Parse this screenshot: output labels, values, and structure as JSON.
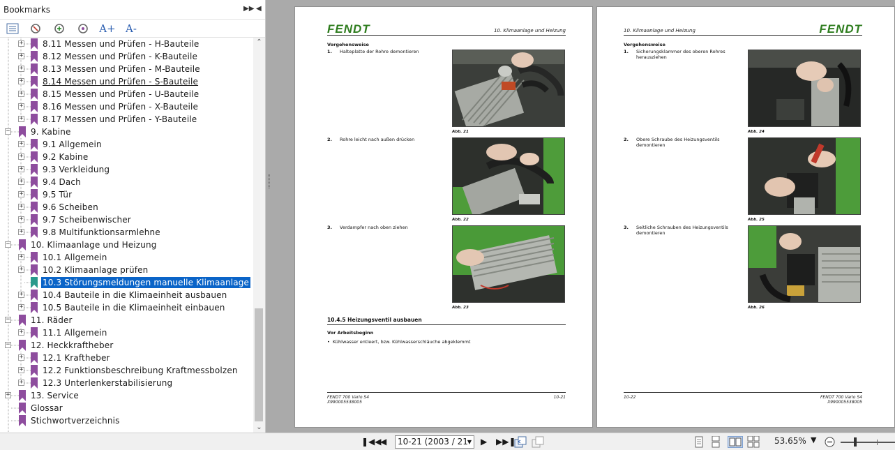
{
  "panel": {
    "title": "Bookmarks",
    "toolbar": [
      "expand-all-icon",
      "delete-bookmark-icon",
      "add-bookmark-icon",
      "bookmark-properties-icon",
      "increase-text-size-icon",
      "decrease-text-size-icon"
    ],
    "increase_text": "A+",
    "decrease_text": "A-"
  },
  "bookmarks": [
    {
      "label": "8.11 Messen und Prüfen - H-Bauteile",
      "level": 2,
      "expander": "plus"
    },
    {
      "label": "8.12 Messen und Prüfen - K-Bauteile",
      "level": 2,
      "expander": "plus"
    },
    {
      "label": "8.13 Messen und Prüfen - M-Bauteile",
      "level": 2,
      "expander": "plus"
    },
    {
      "label": "8.14 Messen und Prüfen - S-Bauteile",
      "level": 2,
      "expander": "plus",
      "state": "hover"
    },
    {
      "label": "8.15 Messen und Prüfen - U-Bauteile",
      "level": 2,
      "expander": "plus"
    },
    {
      "label": "8.16 Messen und Prüfen - X-Bauteile",
      "level": 2,
      "expander": "plus"
    },
    {
      "label": "8.17 Messen und Prüfen - Y-Bauteile",
      "level": 2,
      "expander": "plus"
    },
    {
      "label": "9. Kabine",
      "level": 1,
      "expander": "minus"
    },
    {
      "label": "9.1 Allgemein",
      "level": 2,
      "expander": "plus"
    },
    {
      "label": "9.2 Kabine",
      "level": 2,
      "expander": "plus"
    },
    {
      "label": "9.3 Verkleidung",
      "level": 2,
      "expander": "plus"
    },
    {
      "label": "9.4 Dach",
      "level": 2,
      "expander": "plus"
    },
    {
      "label": "9.5 Tür",
      "level": 2,
      "expander": "plus"
    },
    {
      "label": "9.6 Scheiben",
      "level": 2,
      "expander": "plus"
    },
    {
      "label": "9.7 Scheibenwischer",
      "level": 2,
      "expander": "plus"
    },
    {
      "label": "9.8 Multifunktionsarmlehne",
      "level": 2,
      "expander": "plus"
    },
    {
      "label": "10. Klimaanlage und Heizung",
      "level": 1,
      "expander": "minus"
    },
    {
      "label": "10.1 Allgemein",
      "level": 2,
      "expander": "plus"
    },
    {
      "label": "10.2 Klimaanlage prüfen",
      "level": 2,
      "expander": "plus"
    },
    {
      "label": "10.3 Störungsmeldungen manuelle Klimaanlage",
      "level": 2,
      "expander": "none",
      "state": "selected"
    },
    {
      "label": "10.4 Bauteile in die Klimaeinheit ausbauen",
      "level": 2,
      "expander": "plus"
    },
    {
      "label": "10.5 Bauteile in die Klimaeinheit einbauen",
      "level": 2,
      "expander": "plus"
    },
    {
      "label": "11. Räder",
      "level": 1,
      "expander": "minus"
    },
    {
      "label": "11.1 Allgemein",
      "level": 2,
      "expander": "plus"
    },
    {
      "label": "12. Heckkraftheber",
      "level": 1,
      "expander": "minus"
    },
    {
      "label": "12.1 Kraftheber",
      "level": 2,
      "expander": "plus"
    },
    {
      "label": "12.2 Funktionsbeschreibung Kraftmessbolzen",
      "level": 2,
      "expander": "plus"
    },
    {
      "label": "12.3 Unterlenkerstabilisierung",
      "level": 2,
      "expander": "plus"
    },
    {
      "label": "13. Service",
      "level": 1,
      "expander": "plus"
    },
    {
      "label": "Glossar",
      "level": 1,
      "expander": "none"
    },
    {
      "label": "Stichwortverzeichnis",
      "level": 1,
      "expander": "none"
    }
  ],
  "colors": {
    "bookmark": "#8e4d9e",
    "bookmark_selected": "#2a9a8c",
    "selection": "#0a64c8",
    "fendt_green": "#2f7d1f",
    "viewer_bg": "#aaaaaa"
  },
  "page_left": {
    "logo": "FENDT",
    "chapter": "10. Klimaanlage und Heizung",
    "section": "Vorgehensweise",
    "steps": [
      {
        "num": "1.",
        "text": "Halteplatte der Rohre demontieren",
        "caption": "Abb. 21"
      },
      {
        "num": "2.",
        "text": "Rohre leicht nach außen drücken",
        "caption": "Abb. 22"
      },
      {
        "num": "3.",
        "text": "Verdampfer nach oben ziehen",
        "caption": "Abb. 23"
      }
    ],
    "subheading": "10.4.5  Heizungsventil ausbauen",
    "sub_section": "Vor Arbeitsbeginn",
    "bullet": "Kühlwasser entleert, bzw. Kühlwasserschläuche abgeklemmt",
    "footer_left": "FENDT 700 Vario S4",
    "footer_left2": "X990005538005",
    "footer_right": "10-21"
  },
  "page_right": {
    "logo": "FENDT",
    "chapter": "10. Klimaanlage und Heizung",
    "section": "Vorgehensweise",
    "steps": [
      {
        "num": "1.",
        "text": "Sicherungsklammer des oberen Rohres herausziehen",
        "caption": "Abb. 24"
      },
      {
        "num": "2.",
        "text": "Obere Schraube des Heizungsventils demontieren",
        "caption": "Abb. 25"
      },
      {
        "num": "3.",
        "text": "Seitliche Schrauben des Heizungsventils demontieren",
        "caption": "Abb. 26"
      }
    ],
    "footer_left": "10-22",
    "footer_right": "FENDT 700 Vario S4",
    "footer_right2": "X990005538005"
  },
  "bottombar": {
    "page_field": "10-21 (2003 / 21",
    "zoom": "53.65%"
  }
}
